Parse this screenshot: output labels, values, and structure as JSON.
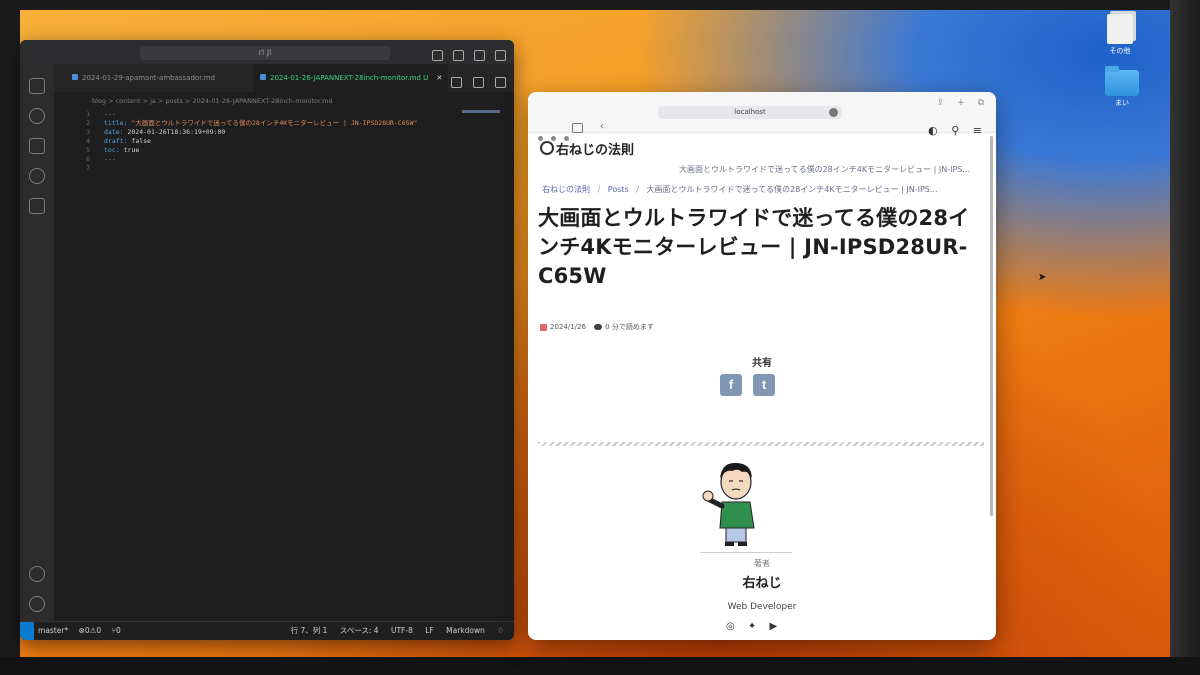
{
  "desktop": {
    "icons": [
      {
        "label": "その他"
      },
      {
        "label": "まい"
      }
    ]
  },
  "vscode": {
    "search": "rl Jl",
    "tabs": [
      {
        "label": "2024-01-29-apamant-ambassador.md"
      },
      {
        "label": "2024-01-26-JAPANNEXT-28inch-monitor.md  U",
        "active": true
      }
    ],
    "breadcrumb": "blog > content > ja > posts > 2024-01-26-JAPANNEXT-28inch-monitor.md",
    "code": [
      {
        "ln": "1",
        "key": "",
        "val": "---"
      },
      {
        "ln": "2",
        "key": "title: ",
        "val": "\"大画面とウルトラワイドで迷ってる僕の28インチ4Kモニターレビュー | JN-IPSD28UR-C65W\""
      },
      {
        "ln": "3",
        "key": "date: ",
        "val": "2024-01-26T18:36:19+09:00"
      },
      {
        "ln": "4",
        "key": "draft: ",
        "val": "false"
      },
      {
        "ln": "5",
        "key": "toc: ",
        "val": "true"
      },
      {
        "ln": "6",
        "key": "",
        "val": "---"
      },
      {
        "ln": "7",
        "key": "",
        "val": ""
      }
    ],
    "status": {
      "branch": "master*",
      "problems": "⊗0⚠0",
      "ports": "⑂0",
      "position": "行 7、列 1",
      "spaces": "スペース: 4",
      "encoding": "UTF-8",
      "eol": "LF",
      "language": "Markdown"
    }
  },
  "browser": {
    "url": "localhost",
    "site_title": "右ねじの法則",
    "nav_tail": "大画面とウルトラワイドで迷ってる僕の28インチ4Kモニターレビュー | JN-IPS...",
    "breadcrumb": {
      "home": "右ねじの法則",
      "section": "Posts",
      "current": "大画面とウルトラワイドで迷ってる僕の28インチ4Kモニターレビュー | JN-IPS..."
    },
    "post": {
      "title": "大画面とウルトラワイドで迷ってる僕の28インチ4Kモニターレビュー | JN-IPSD28UR-C65W",
      "date": "2024/1/26",
      "reading_time": "0 分で読めます"
    },
    "share": {
      "label": "共有",
      "facebook": "f",
      "twitter": "t"
    },
    "author": {
      "label": "著者",
      "name": "右ねじ",
      "role": "Web Developer"
    },
    "social_icons": [
      "instagram-icon",
      "twitter-icon",
      "youtube-icon"
    ]
  },
  "colors": {
    "vscode_bg": "#1e1e1e",
    "tab_active": "#3fd28a",
    "share_btn": "#7f97b2",
    "link": "#5566aa"
  }
}
